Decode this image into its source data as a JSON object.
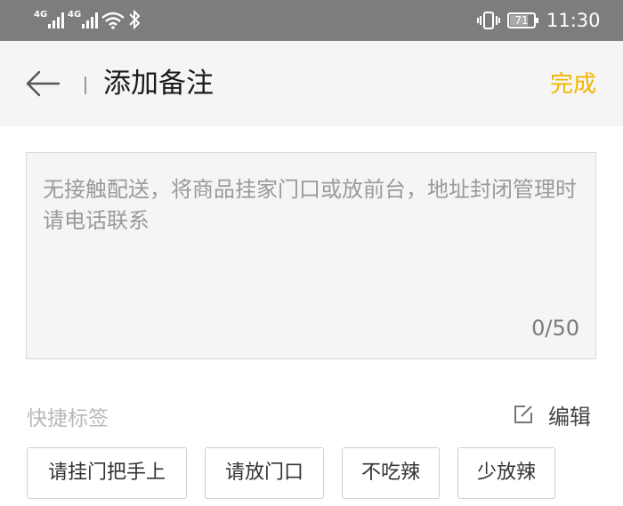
{
  "status_bar": {
    "sim1_network": "4G",
    "sim2_network": "4G",
    "battery_level": "71",
    "time": "11:30",
    "icons": [
      "signal-icon",
      "wifi-icon",
      "bluetooth-icon",
      "vibrate-icon",
      "battery-icon"
    ]
  },
  "header": {
    "back_icon": "back-arrow-icon",
    "title": "添加备注",
    "done_label": "完成"
  },
  "note": {
    "placeholder": "无接触配送，将商品挂家门口或放前台，地址封闭管理时请电话联系",
    "value": "",
    "counter": "0/50"
  },
  "quick_tags": {
    "label": "快捷标签",
    "edit_icon": "edit-icon",
    "edit_label": "编辑",
    "tags": [
      {
        "label": "请挂门把手上"
      },
      {
        "label": "请放门口"
      },
      {
        "label": "不吃辣"
      },
      {
        "label": "少放辣"
      }
    ]
  },
  "colors": {
    "status_bar_bg": "#7d7d7d",
    "accent": "#f2b600",
    "page_bg": "#f5f5f5"
  }
}
